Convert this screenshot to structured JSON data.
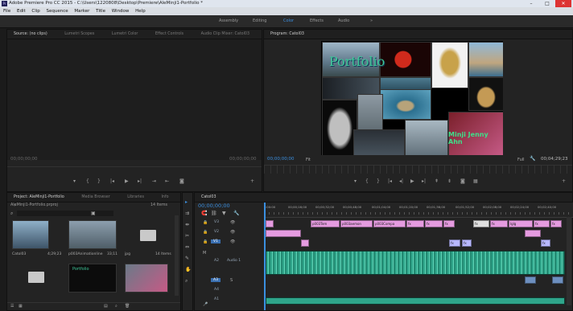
{
  "window": {
    "title": "Adobe Premiere Pro CC 2015 - C:\\Users\\1220808\\Desktop\\Premiere\\AleMinji1-Portfolio *"
  },
  "menu": [
    "File",
    "Edit",
    "Clip",
    "Sequence",
    "Marker",
    "Title",
    "Window",
    "Help"
  ],
  "workspaces": [
    "Assembly",
    "Editing",
    "Color",
    "Effects",
    "Audio",
    "»"
  ],
  "active_workspace": "Color",
  "source_panel": {
    "tabs": [
      "Source: (no clips)",
      "Lumetri Scopes",
      "Lumetri Color",
      "Effect Controls",
      "Audio Clip Mixer: Catol03"
    ],
    "timecode_left": "00;00;00;00",
    "timecode_right": "00;00;00;00"
  },
  "program_panel": {
    "tab": "Program: Catol03",
    "timecode": "00;00;00;00",
    "fit": "Fit",
    "quality": "Full",
    "duration": "00;04;29;23",
    "title_overlay": "Portfolio",
    "credit_overlay": "Minji Jenny Ahn"
  },
  "project_panel": {
    "tabs": [
      "Project: AleMinji1-Portfolio",
      "Media Browser",
      "Libraries",
      "Info",
      "»"
    ],
    "project_file": "AleMinji1-Portfolio.prproj",
    "items_count": "14 Items",
    "items": [
      {
        "name": "Catol03",
        "duration": "4;29;23"
      },
      {
        "name": "p003Animationline",
        "duration": "33;11"
      },
      {
        "name": "jpg",
        "duration": ""
      },
      {
        "name": "",
        "duration": "14 Items"
      },
      {
        "name": "Portfolio",
        "duration": ""
      }
    ]
  },
  "timeline": {
    "tab": "Catol03",
    "timecode": "00;00;00;00",
    "ruler": [
      ":00:00",
      "00;00;16;00",
      "00;00;32;00",
      "00;00;48;00",
      "00;01;04;00",
      "00;01;20;00",
      "00;01;36;00",
      "00;01;52;00",
      "00;02;08;00",
      "00;02;24;00",
      "00;02;40;00"
    ],
    "tracks": [
      "V3",
      "V2",
      "V1",
      "A1",
      "A2",
      "A3",
      "A4",
      "A1"
    ],
    "audio_label": "Audio 1",
    "clip_labels": [
      "p003Tem",
      "p003aemon",
      "p003Compa",
      "fx",
      "fx",
      "fx",
      "fx",
      "fx",
      "fx",
      "fx",
      "fx",
      "fx",
      "lglg",
      "fx"
    ]
  },
  "colors": {
    "accent": "#3a8fe0",
    "pink_clip": "#e59be0",
    "audio_clip": "#2fa58a",
    "lavender_clip": "#b8b8ff"
  }
}
